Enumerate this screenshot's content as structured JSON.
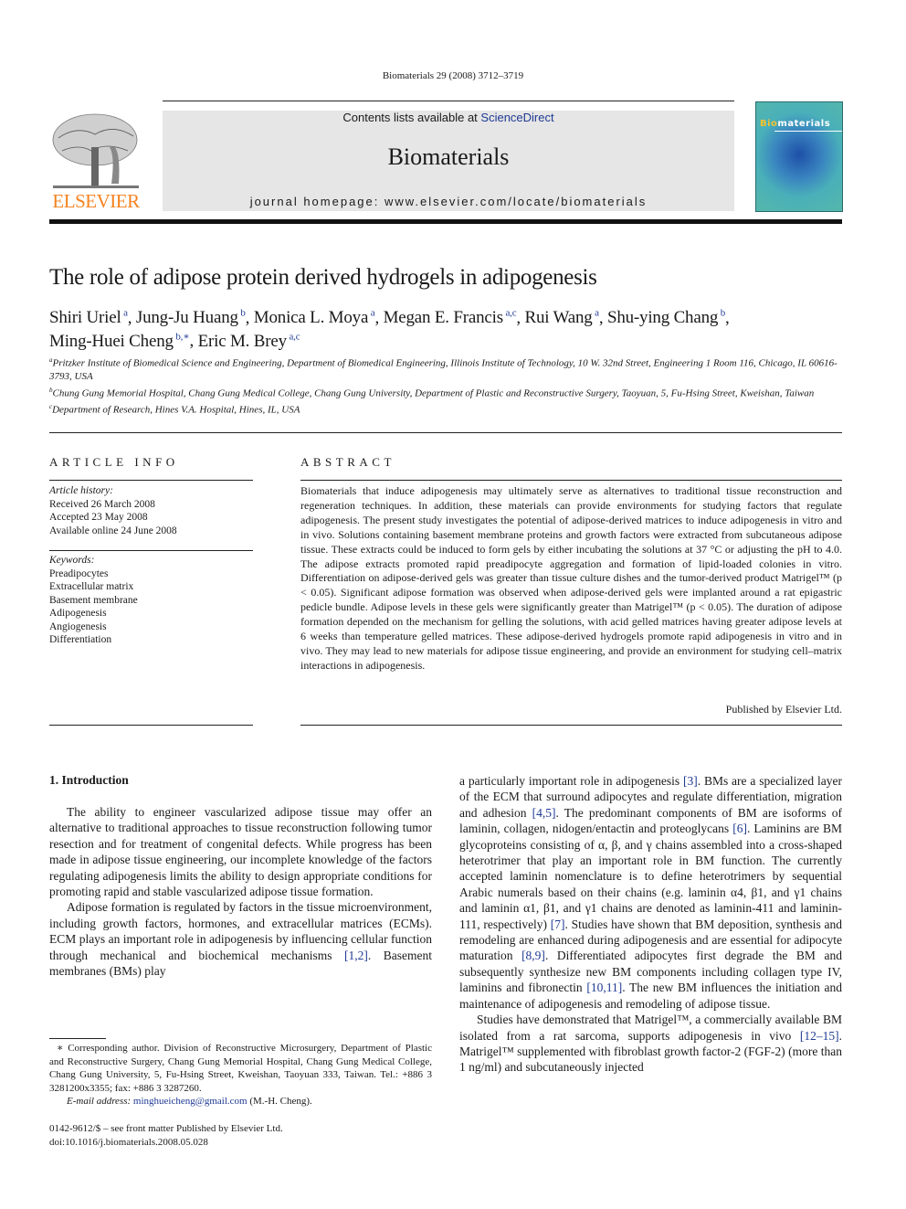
{
  "header": {
    "running_head": "Biomaterials 29 (2008) 3712–3719",
    "contents_prefix": "Contents lists available at ",
    "contents_link": "ScienceDirect",
    "journal_title": "Biomaterials",
    "homepage": "journal homepage: www.elsevier.com/locate/biomaterials",
    "publisher_logo_text": "ELSEVIER",
    "cover_title_highlight": "Bio",
    "cover_title_rest": "materials"
  },
  "colors": {
    "link": "#1f3a93",
    "elsevier_orange": "#f58220",
    "banner_bg": "#e6e6e6"
  },
  "article": {
    "title": "The role of adipose protein derived hydrogels in adipogenesis",
    "authors": [
      {
        "name": "Shiri Uriel",
        "sup": "a"
      },
      {
        "name": "Jung-Ju Huang",
        "sup": "b"
      },
      {
        "name": "Monica L. Moya",
        "sup": "a"
      },
      {
        "name": "Megan E. Francis",
        "sup": "a,c"
      },
      {
        "name": "Rui Wang",
        "sup": "a"
      },
      {
        "name": "Shu-ying Chang",
        "sup": "b"
      },
      {
        "name": "Ming-Huei Cheng",
        "sup": "b,∗"
      },
      {
        "name": "Eric M. Brey",
        "sup": "a,c"
      }
    ],
    "affiliations": [
      {
        "sup": "a",
        "text": "Pritzker Institute of Biomedical Science and Engineering, Department of Biomedical Engineering, Illinois Institute of Technology, 10 W. 32nd Street, Engineering 1 Room 116, Chicago, IL 60616-3793, USA"
      },
      {
        "sup": "b",
        "text": "Chung Gung Memorial Hospital, Chang Gung Medical College, Chang Gung University, Department of Plastic and Reconstructive Surgery, Taoyuan, 5, Fu-Hsing Street, Kweishan, Taiwan"
      },
      {
        "sup": "c",
        "text": "Department of Research, Hines V.A. Hospital, Hines, IL, USA"
      }
    ]
  },
  "article_info": {
    "heading": "ARTICLE INFO",
    "history_label": "Article history:",
    "history": [
      "Received 26 March 2008",
      "Accepted 23 May 2008",
      "Available online 24 June 2008"
    ],
    "keywords_label": "Keywords:",
    "keywords": [
      "Preadipocytes",
      "Extracellular matrix",
      "Basement membrane",
      "Adipogenesis",
      "Angiogenesis",
      "Differentiation"
    ]
  },
  "abstract": {
    "heading": "ABSTRACT",
    "text": "Biomaterials that induce adipogenesis may ultimately serve as alternatives to traditional tissue reconstruction and regeneration techniques. In addition, these materials can provide environments for studying factors that regulate adipogenesis. The present study investigates the potential of adipose-derived matrices to induce adipogenesis in vitro and in vivo. Solutions containing basement membrane proteins and growth factors were extracted from subcutaneous adipose tissue. These extracts could be induced to form gels by either incubating the solutions at 37 °C or adjusting the pH to 4.0. The adipose extracts promoted rapid preadipocyte aggregation and formation of lipid-loaded colonies in vitro. Differentiation on adipose-derived gels was greater than tissue culture dishes and the tumor-derived product Matrigel™ (p < 0.05). Significant adipose formation was observed when adipose-derived gels were implanted around a rat epigastric pedicle bundle. Adipose levels in these gels were significantly greater than Matrigel™ (p < 0.05). The duration of adipose formation depended on the mechanism for gelling the solutions, with acid gelled matrices having greater adipose levels at 6 weeks than temperature gelled matrices. These adipose-derived hydrogels promote rapid adipogenesis in vitro and in vivo. They may lead to new materials for adipose tissue engineering, and provide an environment for studying cell–matrix interactions in adipogenesis.",
    "published_by": "Published by Elsevier Ltd."
  },
  "body": {
    "section_heading": "1.  Introduction",
    "left_paragraphs": [
      "The ability to engineer vascularized adipose tissue may offer an alternative to traditional approaches to tissue reconstruction following tumor resection and for treatment of congenital defects. While progress has been made in adipose tissue engineering, our incomplete knowledge of the factors regulating adipogenesis limits the ability to design appropriate conditions for promoting rapid and stable vascularized adipose tissue formation.",
      "Adipose formation is regulated by factors in the tissue microenvironment, including growth factors, hormones, and extracellular matrices (ECMs). ECM plays an important role in adipogenesis by influencing cellular function through mechanical and biochemical mechanisms [1,2]. Basement membranes (BMs) play"
    ],
    "right_paragraphs": [
      "a particularly important role in adipogenesis [3]. BMs are a specialized layer of the ECM that surround adipocytes and regulate differentiation, migration and adhesion [4,5]. The predominant components of BM are isoforms of laminin, collagen, nidogen/entactin and proteoglycans [6]. Laminins are BM glycoproteins consisting of α, β, and γ chains assembled into a cross-shaped heterotrimer that play an important role in BM function. The currently accepted laminin nomenclature is to define heterotrimers by sequential Arabic numerals based on their chains (e.g. laminin α4, β1, and γ1 chains and laminin α1, β1, and γ1 chains are denoted as laminin-411 and laminin-111, respectively) [7]. Studies have shown that BM deposition, synthesis and remodeling are enhanced during adipogenesis and are essential for adipocyte maturation [8,9]. Differentiated adipocytes first degrade the BM and subsequently synthesize new BM components including collagen type IV, laminins and fibronectin [10,11]. The new BM influences the initiation and maintenance of adipogenesis and remodeling of adipose tissue.",
      "Studies have demonstrated that Matrigel™, a commercially available BM isolated from a rat sarcoma, supports adipogenesis in vivo [12–15]. Matrigel™ supplemented with fibroblast growth factor-2 (FGF-2) (more than 1 ng/ml) and subcutaneously injected"
    ]
  },
  "footnotes": {
    "corresponding": "∗ Corresponding author. Division of Reconstructive Microsurgery, Department of Plastic and Reconstructive Surgery, Chang Gung Memorial Hospital, Chang Gung Medical College, Chang Gung University, 5, Fu-Hsing Street, Kweishan, Taoyuan 333, Taiwan. Tel.: +886 3 3281200x3355; fax: +886 3 3287260.",
    "email_label": "E-mail address: ",
    "email": "minghueicheng@gmail.com",
    "email_suffix": " (M.-H. Cheng).",
    "front_matter": "0142-9612/$ – see front matter Published by Elsevier Ltd.",
    "doi": "doi:10.1016/j.biomaterials.2008.05.028"
  }
}
